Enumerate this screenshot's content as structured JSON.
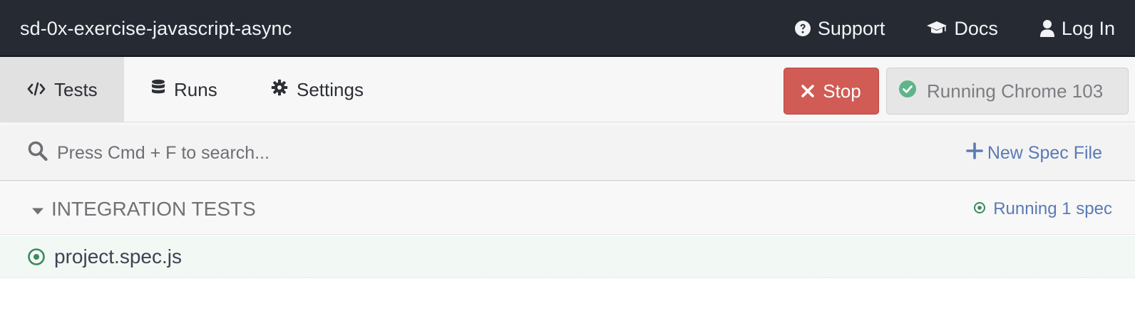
{
  "topbar": {
    "project_name": "sd-0x-exercise-javascript-async",
    "nav": [
      {
        "label": "Support",
        "icon": "question-circle-icon"
      },
      {
        "label": "Docs",
        "icon": "graduation-cap-icon"
      },
      {
        "label": "Log In",
        "icon": "user-icon"
      }
    ]
  },
  "tabs": [
    {
      "label": "Tests",
      "icon": "code-icon",
      "active": true
    },
    {
      "label": "Runs",
      "icon": "database-icon",
      "active": false
    },
    {
      "label": "Settings",
      "icon": "gear-icon",
      "active": false
    }
  ],
  "actions": {
    "stop_label": "Stop",
    "browser_label": "Running Chrome 103"
  },
  "search": {
    "placeholder": "Press Cmd + F to search...",
    "value": ""
  },
  "new_spec_label": "New Spec File",
  "section": {
    "title": "INTEGRATION TESTS",
    "status": "Running 1 spec"
  },
  "specs": [
    {
      "name": "project.spec.js",
      "status": "running"
    }
  ],
  "colors": {
    "topbar_bg": "#262a33",
    "stop_bg": "#d15b55",
    "link_blue": "#5a7bb5",
    "running_green": "#3b8a5f",
    "check_green": "#5fb58a"
  }
}
